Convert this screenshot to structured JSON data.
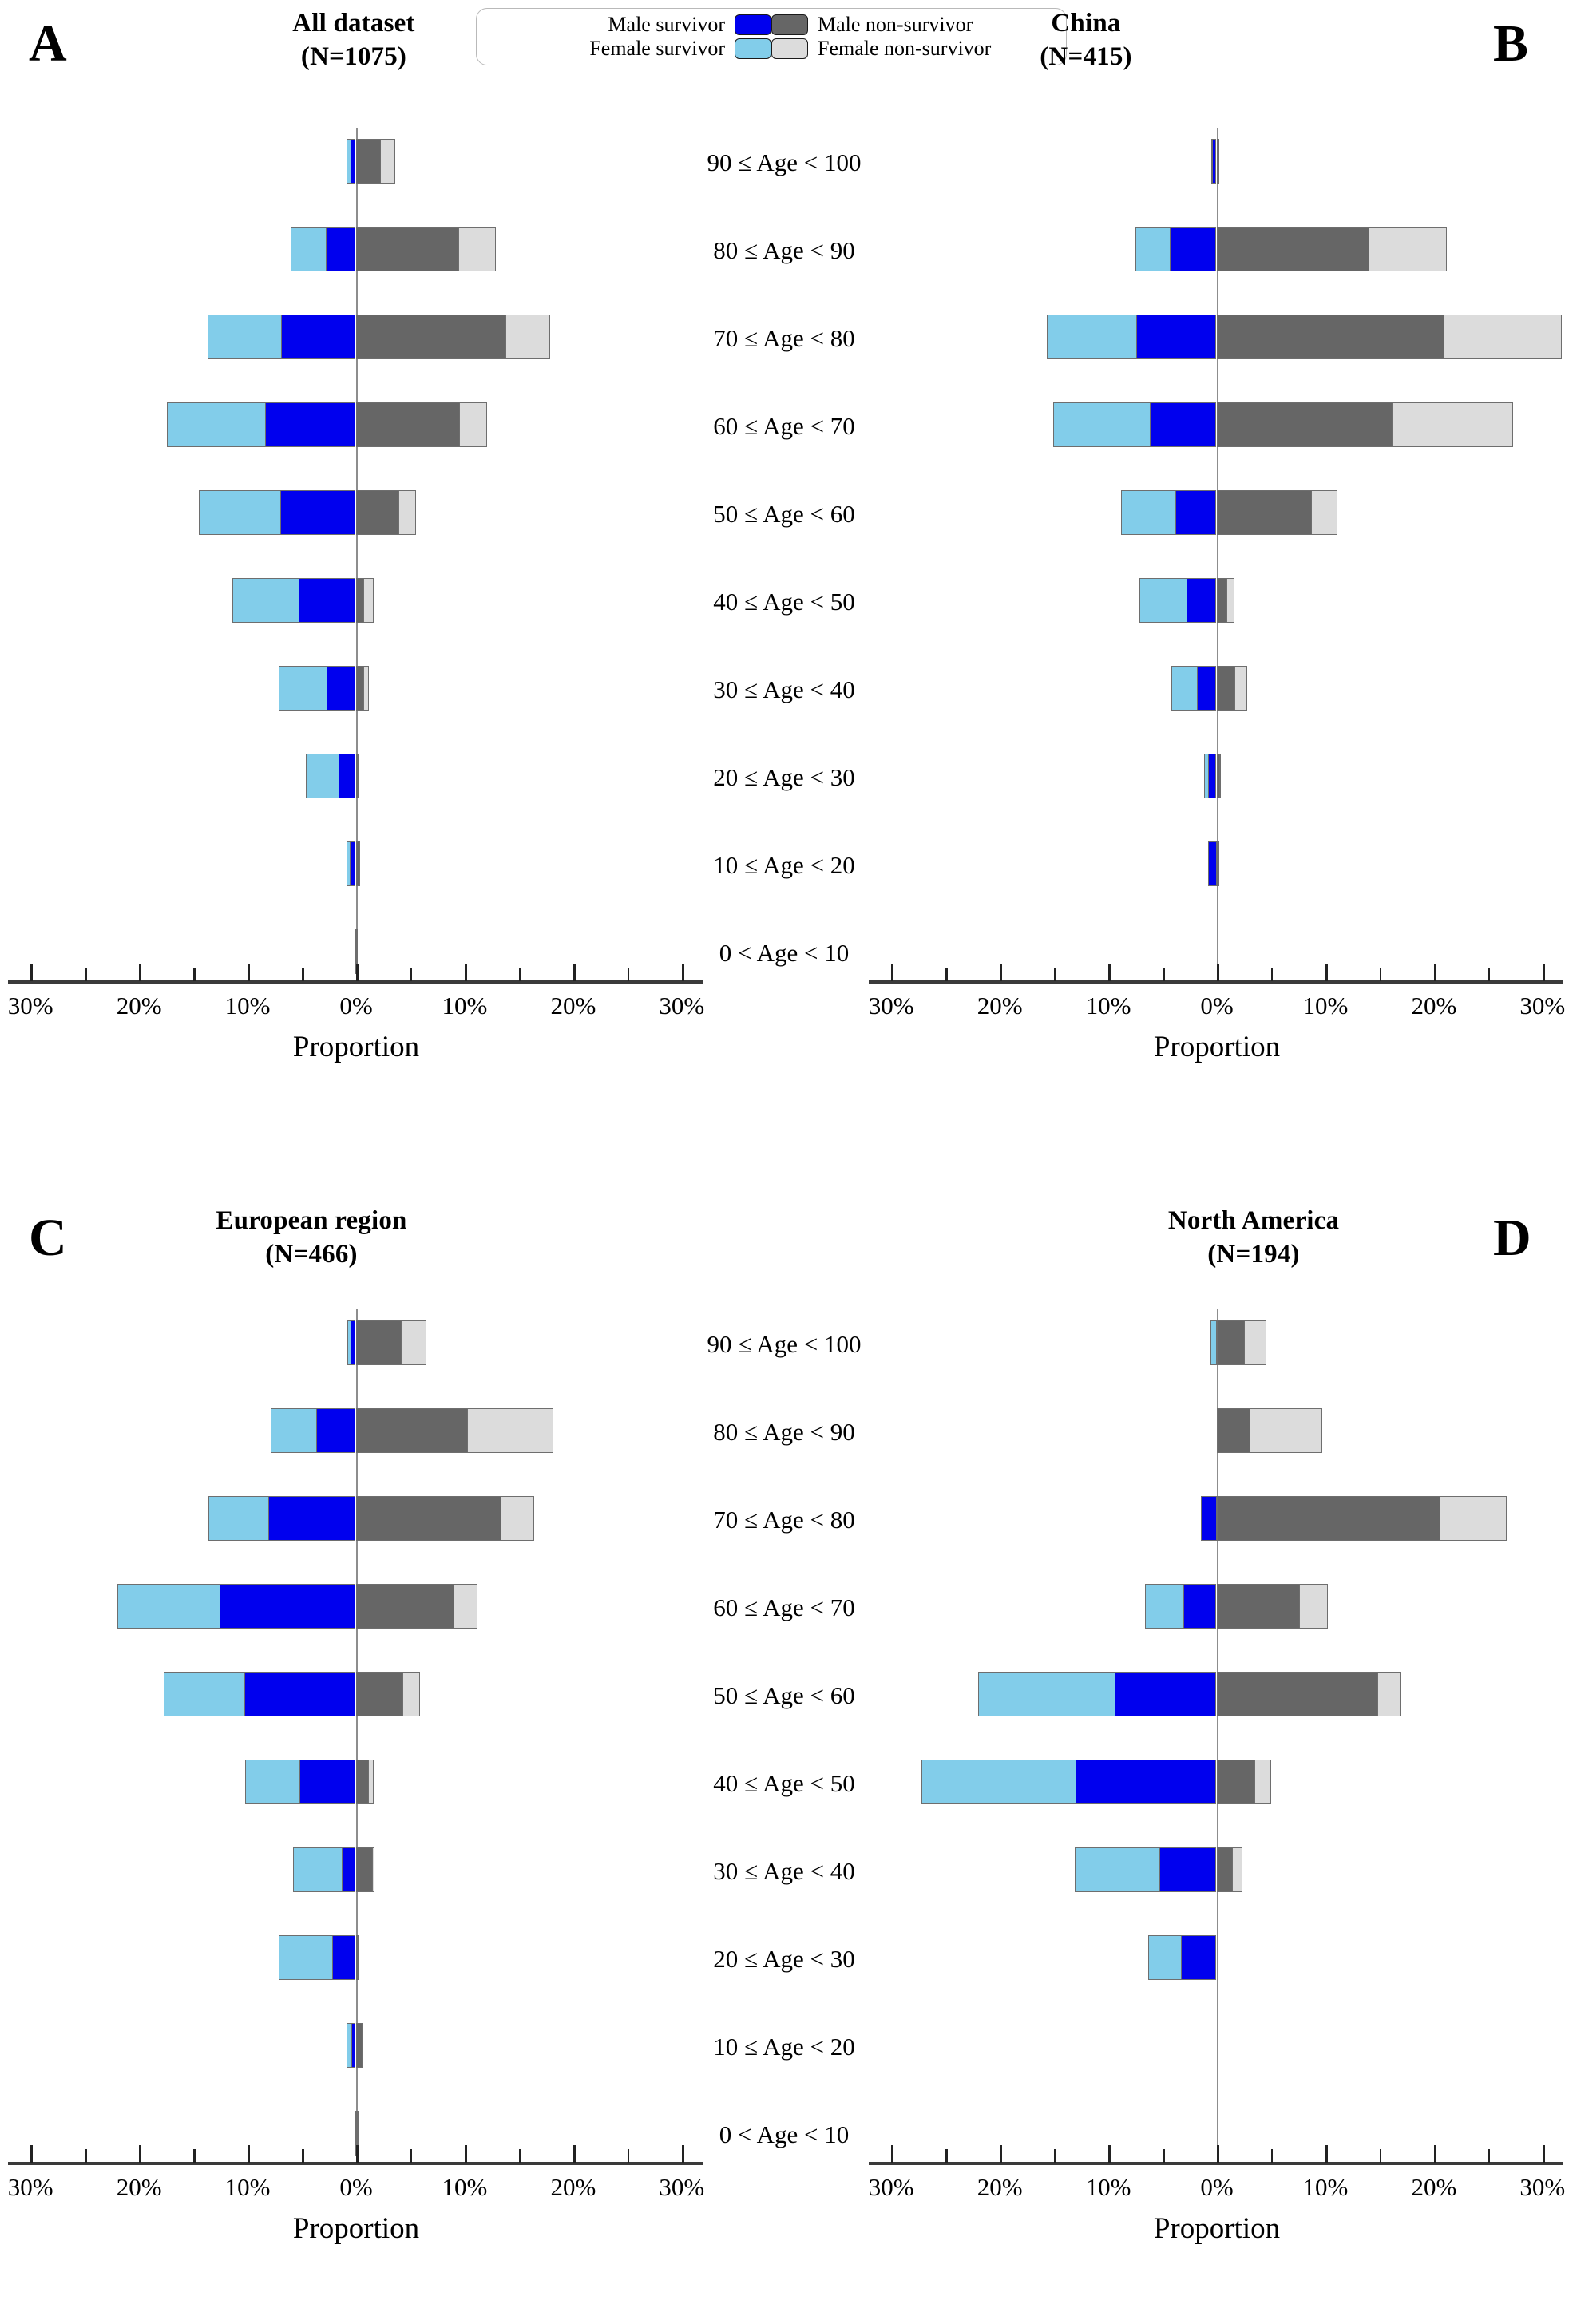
{
  "figure": {
    "colors": {
      "male_survivor": "#0000ee",
      "female_survivor": "#82cdea",
      "male_non_survivor": "#666666",
      "female_non_survivor": "#dcdcdc",
      "bar_outline": "#6e6e6e",
      "axis": "#3a3a3a",
      "zero_line": "#8d8d8d"
    },
    "legend": {
      "items": [
        {
          "label": "Male survivor",
          "color_key": "male_survivor",
          "swatch_name": "male-survivor-swatch"
        },
        {
          "label": "Male non-survivor",
          "color_key": "male_non_survivor",
          "swatch_name": "male-non-survivor-swatch"
        },
        {
          "label": "Female survivor",
          "color_key": "female_survivor",
          "swatch_name": "female-survivor-swatch"
        },
        {
          "label": "Female non-survivor",
          "color_key": "female_non_survivor",
          "swatch_name": "female-non-survivor-swatch"
        }
      ]
    },
    "age_groups": [
      "90 ≤ Age < 100",
      "80 ≤ Age < 90",
      "70 ≤ Age < 80",
      "60 ≤ Age < 70",
      "50 ≤ Age < 60",
      "40 ≤ Age < 50",
      "30 ≤ Age < 40",
      "20 ≤ Age < 30",
      "10 ≤ Age < 20",
      "0 < Age < 10"
    ],
    "axis": {
      "title": "Proportion",
      "tick_labels": [
        "30%",
        "20%",
        "10%",
        "0%",
        "10%",
        "20%",
        "30%"
      ],
      "tick_values": [
        -30,
        -20,
        -10,
        0,
        10,
        20,
        30
      ],
      "minor_step": 5,
      "limit": 32
    },
    "panels": [
      {
        "letter": "A",
        "title": "All dataset",
        "n_label": "(N=1075)"
      },
      {
        "letter": "B",
        "title": "China",
        "n_label": "(N=415)"
      },
      {
        "letter": "C",
        "title": "European region",
        "n_label": "(N=466)"
      },
      {
        "letter": "D",
        "title": "North America",
        "n_label": "(N=194)"
      }
    ]
  },
  "chart_data": [
    {
      "id": "A",
      "type": "bar",
      "orientation": "horizontal-diverging",
      "title": "All dataset (N=1075)",
      "xlabel": "Proportion",
      "ylabel": "",
      "xlim": [
        -32,
        32
      ],
      "grid": false,
      "legend_position": "top-center",
      "categories": [
        "90 ≤ Age < 100",
        "80 ≤ Age < 90",
        "70 ≤ Age < 80",
        "60 ≤ Age < 70",
        "50 ≤ Age < 60",
        "40 ≤ Age < 50",
        "30 ≤ Age < 40",
        "20 ≤ Age < 30",
        "10 ≤ Age < 20",
        "0 < Age < 10"
      ],
      "series": [
        {
          "name": "Female survivor",
          "side": "left",
          "values": [
            0.5,
            3.3,
            6.9,
            9.1,
            7.6,
            6.2,
            4.5,
            3.1,
            0.4,
            0.0
          ]
        },
        {
          "name": "Male survivor",
          "side": "left",
          "values": [
            0.4,
            2.7,
            6.8,
            8.3,
            6.9,
            5.2,
            2.6,
            1.5,
            0.5,
            0.1
          ]
        },
        {
          "name": "Male non-survivor",
          "side": "right",
          "values": [
            2.3,
            9.5,
            13.9,
            9.6,
            4.0,
            0.8,
            0.8,
            0.2,
            0.3,
            0.1
          ]
        },
        {
          "name": "Female non-survivor",
          "side": "right",
          "values": [
            1.4,
            3.5,
            4.1,
            2.6,
            1.6,
            0.9,
            0.5,
            0.1,
            0.1,
            0.0
          ]
        }
      ]
    },
    {
      "id": "B",
      "type": "bar",
      "orientation": "horizontal-diverging",
      "title": "China (N=415)",
      "xlabel": "Proportion",
      "ylabel": "",
      "xlim": [
        -32,
        32
      ],
      "grid": false,
      "legend_position": "top-center",
      "categories": [
        "90 ≤ Age < 100",
        "80 ≤ Age < 90",
        "70 ≤ Age < 80",
        "60 ≤ Age < 70",
        "50 ≤ Age < 60",
        "40 ≤ Age < 50",
        "30 ≤ Age < 40",
        "20 ≤ Age < 30",
        "10 ≤ Age < 20",
        "0 < Age < 10"
      ],
      "series": [
        {
          "name": "Female survivor",
          "side": "left",
          "values": [
            0.2,
            3.3,
            8.4,
            9.0,
            5.1,
            4.4,
            2.5,
            0.5,
            0.0,
            0.0
          ]
        },
        {
          "name": "Male survivor",
          "side": "left",
          "values": [
            0.3,
            4.2,
            7.3,
            6.1,
            3.7,
            2.7,
            1.7,
            0.7,
            0.8,
            0.0
          ]
        },
        {
          "name": "Male non-survivor",
          "side": "right",
          "values": [
            0.2,
            14.1,
            21.0,
            16.2,
            8.8,
            1.0,
            1.7,
            0.3,
            0.2,
            0.0
          ]
        },
        {
          "name": "Female non-survivor",
          "side": "right",
          "values": [
            0.1,
            7.2,
            10.9,
            11.2,
            2.4,
            0.7,
            1.2,
            0.1,
            0.0,
            0.0
          ]
        }
      ]
    },
    {
      "id": "C",
      "type": "bar",
      "orientation": "horizontal-diverging",
      "title": "European region (N=466)",
      "xlabel": "Proportion",
      "ylabel": "",
      "xlim": [
        -32,
        32
      ],
      "grid": false,
      "legend_position": "top-center",
      "categories": [
        "90 ≤ Age < 100",
        "80 ≤ Age < 90",
        "70 ≤ Age < 80",
        "60 ≤ Age < 70",
        "50 ≤ Age < 60",
        "40 ≤ Age < 50",
        "30 ≤ Age < 40",
        "20 ≤ Age < 30",
        "10 ≤ Age < 20",
        "0 < Age < 10"
      ],
      "series": [
        {
          "name": "Female survivor",
          "side": "left",
          "values": [
            0.4,
            4.3,
            5.6,
            9.5,
            7.5,
            5.1,
            4.6,
            5.0,
            0.6,
            0.0
          ]
        },
        {
          "name": "Male survivor",
          "side": "left",
          "values": [
            0.4,
            3.6,
            8.0,
            12.5,
            10.2,
            5.1,
            1.2,
            2.1,
            0.3,
            0.1
          ]
        },
        {
          "name": "Male non-survivor",
          "side": "right",
          "values": [
            4.2,
            10.3,
            13.4,
            9.1,
            4.4,
            1.2,
            1.6,
            0.2,
            0.6,
            0.1
          ]
        },
        {
          "name": "Female non-survivor",
          "side": "right",
          "values": [
            2.4,
            8.0,
            3.1,
            2.2,
            1.6,
            0.5,
            0.2,
            0.1,
            0.2,
            0.1
          ]
        }
      ]
    },
    {
      "id": "D",
      "type": "bar",
      "orientation": "horizontal-diverging",
      "title": "North America (N=194)",
      "xlabel": "Proportion",
      "ylabel": "",
      "xlim": [
        -32,
        32
      ],
      "grid": false,
      "legend_position": "top-center",
      "categories": [
        "90 ≤ Age < 100",
        "80 ≤ Age < 90",
        "70 ≤ Age < 80",
        "60 ≤ Age < 70",
        "50 ≤ Age < 60",
        "40 ≤ Age < 50",
        "30 ≤ Age < 40",
        "20 ≤ Age < 30",
        "10 ≤ Age < 20",
        "0 < Age < 10"
      ],
      "series": [
        {
          "name": "Female survivor",
          "side": "left",
          "values": [
            0.6,
            0.0,
            0.0,
            3.6,
            12.7,
            14.3,
            7.9,
            3.1,
            0.0,
            0.0
          ]
        },
        {
          "name": "Male survivor",
          "side": "left",
          "values": [
            0.0,
            0.0,
            1.5,
            3.0,
            9.3,
            12.9,
            5.2,
            3.2,
            0.0,
            0.0
          ]
        },
        {
          "name": "Male non-survivor",
          "side": "right",
          "values": [
            2.6,
            3.1,
            20.6,
            7.7,
            14.9,
            3.6,
            1.5,
            0.0,
            0.0,
            0.0
          ]
        },
        {
          "name": "Female non-survivor",
          "side": "right",
          "values": [
            2.1,
            6.7,
            6.2,
            2.6,
            2.1,
            1.5,
            1.0,
            0.0,
            0.0,
            0.0
          ]
        }
      ]
    }
  ]
}
